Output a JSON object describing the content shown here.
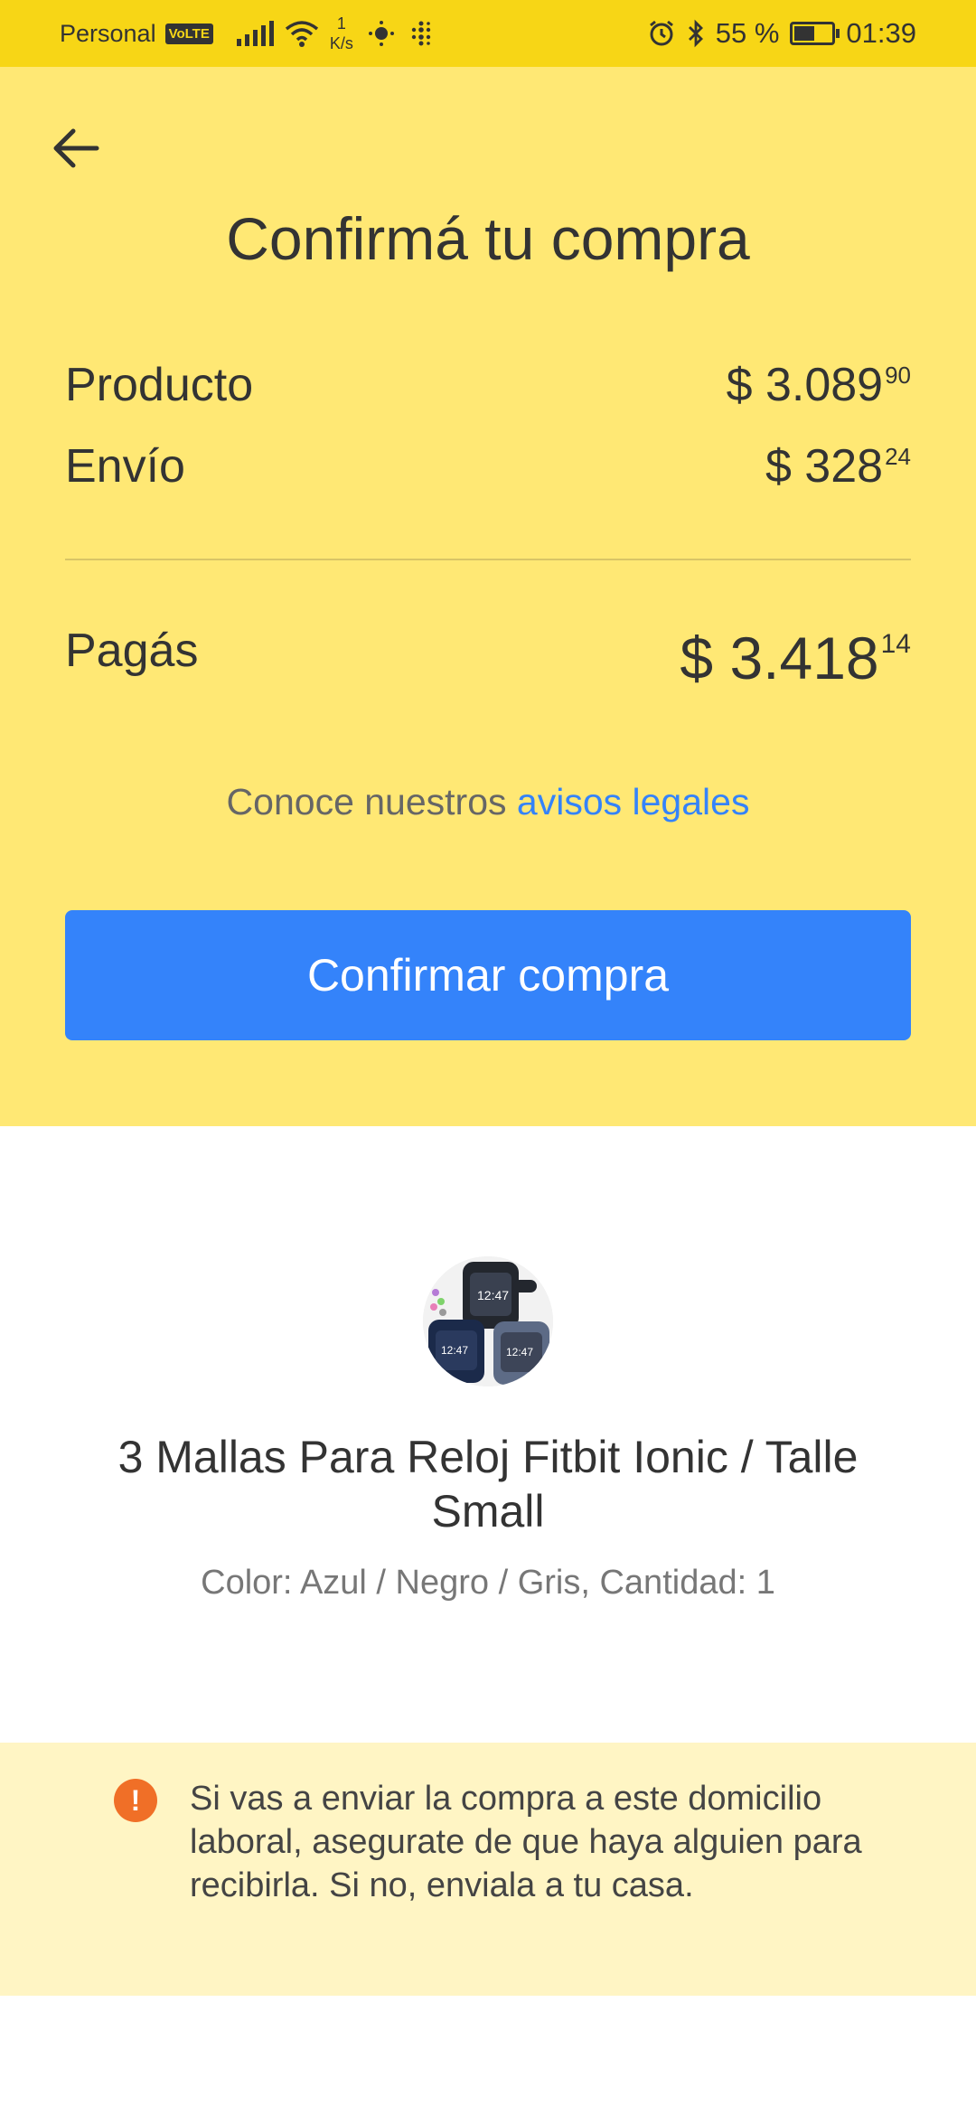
{
  "status_bar": {
    "carrier": "Personal",
    "volte": "VoLTE",
    "speed_value": "1",
    "speed_unit": "K/s",
    "battery_percent": "55 %",
    "battery_level": 0.55,
    "time": "01:39"
  },
  "checkout": {
    "title": "Confirmá tu compra",
    "producto_label": "Producto",
    "producto_amount": "$ 3.089",
    "producto_cents": "90",
    "envio_label": "Envío",
    "envio_amount": "$ 328",
    "envio_cents": "24",
    "total_label": "Pagás",
    "total_amount": "$ 3.418",
    "total_cents": "14",
    "legal_prefix": "Conoce nuestros ",
    "legal_link": "avisos legales",
    "confirm_label": "Confirmar compra"
  },
  "product": {
    "name": "3 Mallas Para Reloj Fitbit Ionic / Talle Small",
    "meta": "Color: Azul / Negro / Gris, Cantidad: 1"
  },
  "warning": {
    "icon": "!",
    "text": "Si vas a enviar la compra a este domicilio laboral, asegurate de que haya alguien para recibirla. Si no, enviala a tu casa."
  },
  "colors": {
    "status_bar": "#f7d616",
    "header_bg": "#ffe874",
    "primary": "#3483fa",
    "warning_bg": "#fff5c4",
    "warning_icon": "#f06f27"
  }
}
